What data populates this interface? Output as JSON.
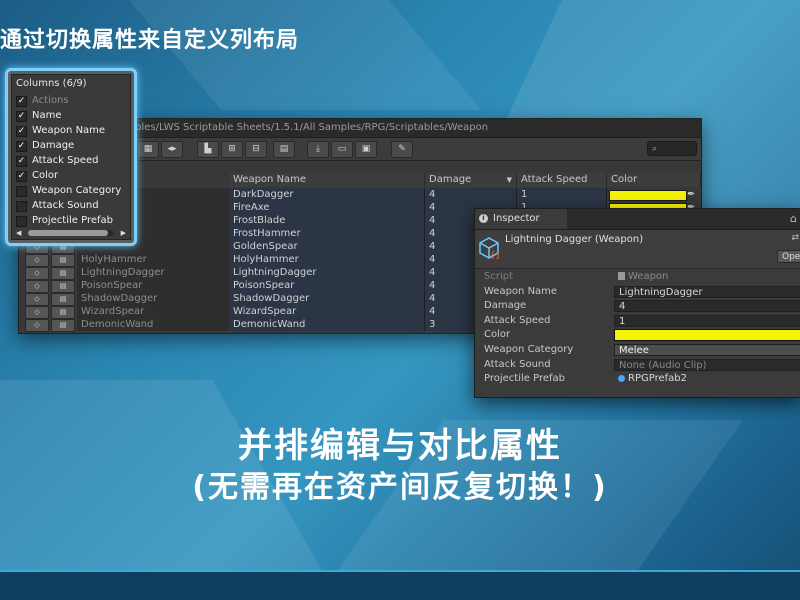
{
  "headline": "通过切换属性来自定义列布局",
  "captions": {
    "line1": "并排编辑与对比属性",
    "line2": "(无需再在资产间反复切换！)"
  },
  "table_window": {
    "path": "ables/LWS Scriptable Sheets/1.5.1/All Samples/RPG/Scriptables/Weapon",
    "search_icon": "⌕",
    "columns": [
      "Weapon Name",
      "Damage",
      "Attack Speed",
      "Color"
    ],
    "rows": [
      {
        "asset": "",
        "name": "DarkDagger",
        "damage": "4",
        "speed": "1",
        "color": "#f5f500"
      },
      {
        "asset": "",
        "name": "FireAxe",
        "damage": "4",
        "speed": "1",
        "color": "#f5f500"
      },
      {
        "asset": "",
        "name": "FrostBlade",
        "damage": "4",
        "speed": "",
        "color": ""
      },
      {
        "asset": "",
        "name": "FrostHammer",
        "damage": "4",
        "speed": "",
        "color": ""
      },
      {
        "asset": "",
        "name": "GoldenSpear",
        "damage": "4",
        "speed": "",
        "color": ""
      },
      {
        "asset": "HolyHammer",
        "name": "HolyHammer",
        "damage": "4",
        "speed": "",
        "color": ""
      },
      {
        "asset": "LightningDagger",
        "name": "LightningDagger",
        "damage": "4",
        "speed": "",
        "color": ""
      },
      {
        "asset": "PoisonSpear",
        "name": "PoisonSpear",
        "damage": "4",
        "speed": "",
        "color": ""
      },
      {
        "asset": "ShadowDagger",
        "name": "ShadowDagger",
        "damage": "4",
        "speed": "",
        "color": ""
      },
      {
        "asset": "WizardSpear",
        "name": "WizardSpear",
        "damage": "4",
        "speed": "",
        "color": ""
      },
      {
        "asset": "DemonicWand",
        "name": "DemonicWand",
        "damage": "3",
        "speed": "",
        "color": ""
      }
    ]
  },
  "columns_popup": {
    "title": "Columns (6/9)",
    "options": [
      {
        "label": "Actions",
        "checked": true,
        "dim": true
      },
      {
        "label": "Name",
        "checked": true,
        "dim": false
      },
      {
        "label": "Weapon Name",
        "checked": true,
        "dim": false
      },
      {
        "label": "Damage",
        "checked": true,
        "dim": false
      },
      {
        "label": "Attack Speed",
        "checked": true,
        "dim": false
      },
      {
        "label": "Color",
        "checked": true,
        "dim": false
      },
      {
        "label": "Weapon Category",
        "checked": false,
        "dim": false
      },
      {
        "label": "Attack Sound",
        "checked": false,
        "dim": false
      },
      {
        "label": "Projectile Prefab",
        "checked": false,
        "dim": false
      }
    ]
  },
  "inspector": {
    "tab": "Inspector",
    "asset_title": "Lightning Dagger (Weapon)",
    "open_label": "Ope",
    "props": [
      {
        "label": "Script",
        "value": "Weapon",
        "kind": "script"
      },
      {
        "label": "Weapon Name",
        "value": "LightningDagger",
        "kind": "text"
      },
      {
        "label": "Damage",
        "value": "4",
        "kind": "text"
      },
      {
        "label": "Attack Speed",
        "value": "1",
        "kind": "text"
      },
      {
        "label": "Color",
        "value": "",
        "kind": "color"
      },
      {
        "label": "Weapon Category",
        "value": "Melee",
        "kind": "dropdown"
      },
      {
        "label": "Attack Sound",
        "value": "None (Audio Clip)",
        "kind": "object-none"
      },
      {
        "label": "Projectile Prefab",
        "value": "RPGPrefab2",
        "kind": "object"
      }
    ]
  },
  "colors": {
    "accent_highlight": "#7ad3ff",
    "color_field": "#f5f500"
  }
}
